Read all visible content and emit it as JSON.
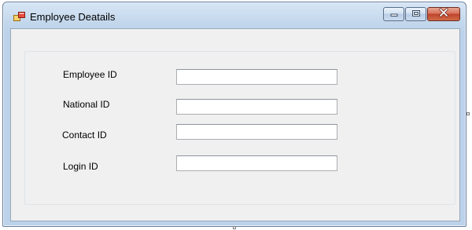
{
  "window": {
    "title": "Employee Deatails",
    "icons": {
      "app": "app-form-icon",
      "minimize": "minimize-icon",
      "maximize": "maximize-icon",
      "close": "close-icon"
    }
  },
  "form": {
    "fields": [
      {
        "label": "Employee ID",
        "value": "",
        "placeholder": ""
      },
      {
        "label": "National ID",
        "value": "",
        "placeholder": ""
      },
      {
        "label": "Contact ID",
        "value": "",
        "placeholder": ""
      },
      {
        "label": "Login ID",
        "value": "",
        "placeholder": ""
      }
    ]
  },
  "colors": {
    "titlebar": "#c3d7ec",
    "client_bg": "#f0f0f0",
    "close_button": "#c0432a"
  }
}
